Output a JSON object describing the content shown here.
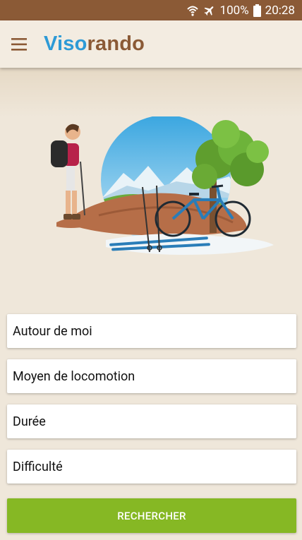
{
  "status_bar": {
    "battery": "100%",
    "time": "20:28",
    "icons": [
      "wifi-calling-icon",
      "airplane-icon",
      "battery-icon"
    ]
  },
  "app_bar": {
    "logo_part1": "Viso",
    "logo_part2": "rando",
    "menu_icon": "hamburger-menu-icon"
  },
  "colors": {
    "status_bar": "#8b5a36",
    "logo_blue": "#2d9ad6",
    "logo_brown": "#8b5a36",
    "background": "#efe7da",
    "button": "#86b824"
  },
  "form": {
    "fields": [
      {
        "label": "Autour de moi"
      },
      {
        "label": "Moyen de locomotion"
      },
      {
        "label": "Durée"
      },
      {
        "label": "Difficulté"
      }
    ],
    "submit_label": "RECHERCHER"
  }
}
